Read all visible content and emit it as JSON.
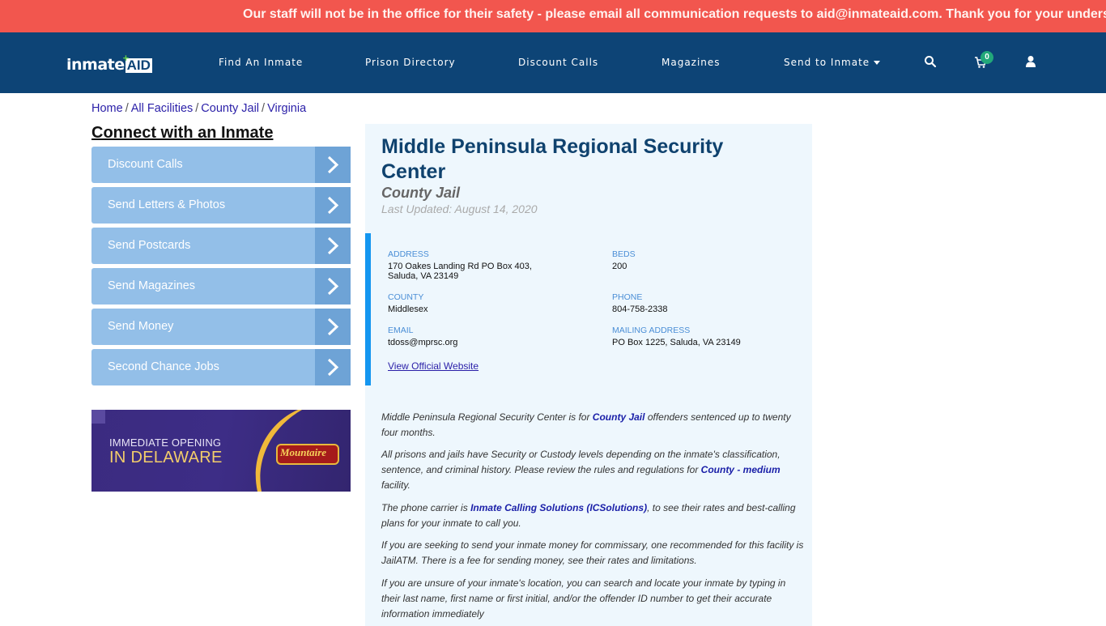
{
  "alert": {
    "text": "Our staff will not be in the office for their safety - please email all communication requests to aid@inmateaid.com. Thank you for your understanding."
  },
  "navbar": {
    "logo_main": "inmate",
    "logo_accent": "AID",
    "links": [
      {
        "label": "Find An Inmate"
      },
      {
        "label": "Prison Directory"
      },
      {
        "label": "Discount Calls"
      },
      {
        "label": "Magazines"
      },
      {
        "label": "Send to Inmate"
      }
    ],
    "cart_count": "0",
    "icons": [
      "search-icon",
      "cart-icon",
      "user-icon"
    ]
  },
  "breadcrumb": {
    "items": [
      "Home",
      "All Facilities",
      "County Jail",
      "Virginia"
    ],
    "separator": "/"
  },
  "sidebar": {
    "title": "Connect with an Inmate",
    "buttons": [
      {
        "label": "Discount Calls"
      },
      {
        "label": "Send Letters & Photos"
      },
      {
        "label": "Send Postcards"
      },
      {
        "label": "Send Magazines"
      },
      {
        "label": "Send Money"
      },
      {
        "label": "Second Chance Jobs"
      }
    ],
    "ad": {
      "line1": "IMMEDIATE OPENING",
      "line2": "IN DELAWARE",
      "brand": "Mountaire"
    }
  },
  "facility": {
    "name": "Middle Peninsula Regional Security Center",
    "type": "County Jail",
    "last_updated": "Last Updated: August 14, 2020",
    "info": {
      "address_label": "ADDRESS",
      "address_line1": "170 Oakes Landing Rd PO Box 403,",
      "address_line2": "Saluda, VA 23149",
      "beds_label": "BEDS",
      "beds": "200",
      "county_label": "COUNTY",
      "county": "Middlesex",
      "phone_label": "PHONE",
      "phone": "804-758-2338",
      "email_label": "EMAIL",
      "email": "tdoss@mprsc.org",
      "mailing_label": "MAILING ADDRESS",
      "mailing": "PO Box 1225, Saluda, VA 23149",
      "website_link": "View Official Website"
    },
    "description": {
      "p1_a": "Middle Peninsula Regional Security Center is for ",
      "p1_link": "County Jail",
      "p1_b": " offenders sentenced up to twenty four months.",
      "p2_a": "All prisons and jails have Security or Custody levels depending on the inmate's classification, sentence, and criminal history. Please review the rules and regulations for ",
      "p2_link": "County - medium",
      "p2_b": " facility.",
      "p3_a": "The phone carrier is ",
      "p3_link": "Inmate Calling Solutions (ICSolutions)",
      "p3_b": ", to see their rates and best-calling plans for your inmate to call you.",
      "p4": "If you are seeking to send your inmate money for commissary, one recommended for this facility is JailATM. There is a fee for sending money, see their rates and limitations.",
      "p5": "If you are unsure of your inmate's location, you can search and locate your inmate by typing in their last name, first name or first initial, and/or the offender ID number to get their accurate information immediately"
    }
  },
  "colors": {
    "alert_bg": "#f2564e",
    "navbar_bg": "#0d4476",
    "sidebar_btn": "#93bfe8",
    "sidebar_arrow": "#6ea3d6",
    "card_bg": "#eef7fd",
    "accent_blue": "#1496f0",
    "title_blue": "#0f426e",
    "link_blue": "#2a1fa8",
    "cart_badge": "#22a87a"
  }
}
